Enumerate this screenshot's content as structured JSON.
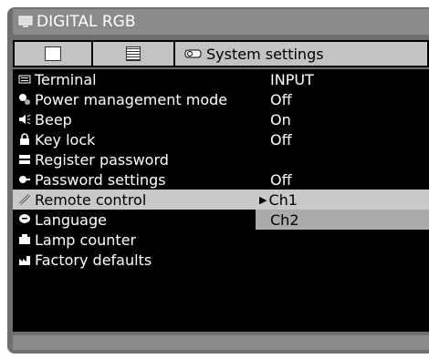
{
  "title": "DIGITAL RGB",
  "tabs": {
    "tab3_label": "System settings"
  },
  "menu": {
    "items": [
      {
        "label": "Terminal",
        "value": "INPUT",
        "icon": "terminal-icon"
      },
      {
        "label": "Power management mode",
        "value": "Off",
        "icon": "power-icon"
      },
      {
        "label": "Beep",
        "value": "On",
        "icon": "speaker-icon"
      },
      {
        "label": "Key lock",
        "value": "Off",
        "icon": "lock-icon"
      },
      {
        "label": "Register password",
        "value": "",
        "icon": "keyboard-icon"
      },
      {
        "label": "Password settings",
        "value": "Off",
        "icon": "password-icon"
      },
      {
        "label": "Remote control",
        "value": "Ch1",
        "icon": "remote-icon"
      },
      {
        "label": "Language",
        "value": "",
        "icon": "speech-bubble-icon"
      },
      {
        "label": "Lamp counter",
        "value": "",
        "icon": "lamp-icon"
      },
      {
        "label": "Factory defaults",
        "value": "",
        "icon": "factory-icon"
      }
    ],
    "remote_option2": "Ch2"
  },
  "colors": {
    "highlight": "#c9c9c9",
    "background": "#000000",
    "frame": "#6f6f6f"
  }
}
